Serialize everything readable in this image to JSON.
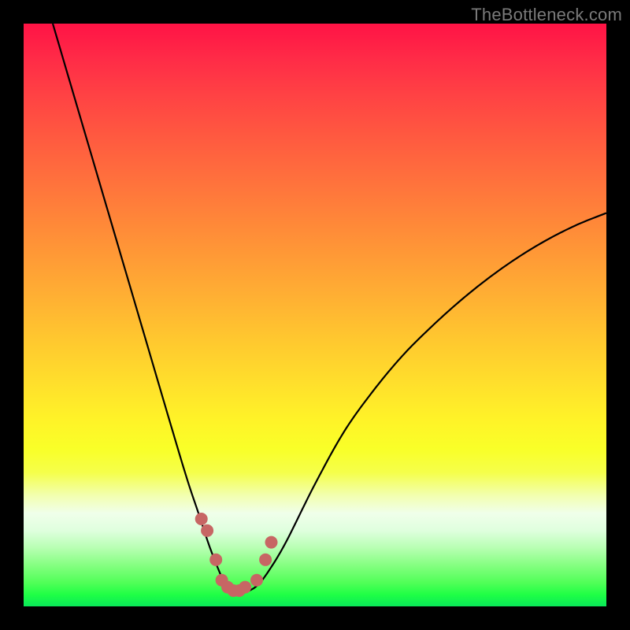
{
  "watermark": "TheBottleneck.com",
  "colors": {
    "frame": "#000000",
    "curve_stroke": "#000000",
    "marker_fill": "#c76664",
    "marker_stroke": "#c76664"
  },
  "chart_data": {
    "type": "line",
    "title": "",
    "xlabel": "",
    "ylabel": "",
    "xlim": [
      0,
      100
    ],
    "ylim": [
      0,
      100
    ],
    "grid": false,
    "legend": false,
    "series": [
      {
        "name": "bottleneck-curve",
        "x": [
          5,
          10,
          15,
          20,
          25,
          28,
          30,
          32,
          34,
          35,
          36,
          37,
          38,
          40,
          42,
          45,
          50,
          55,
          60,
          65,
          70,
          75,
          80,
          85,
          90,
          95,
          100
        ],
        "y": [
          100,
          83,
          66,
          49,
          32,
          22,
          16,
          10,
          5,
          3.2,
          2.4,
          2.2,
          2.4,
          3.5,
          6,
          11,
          21,
          30,
          37,
          43,
          48,
          52.5,
          56.5,
          60,
          63,
          65.5,
          67.5
        ]
      }
    ],
    "markers": {
      "series": "bottleneck-curve",
      "points_x": [
        30.5,
        31.5,
        33,
        34,
        35,
        36,
        37,
        38,
        40,
        41.5,
        42.5
      ],
      "points_y": [
        15,
        13,
        8,
        4.5,
        3.3,
        2.7,
        2.7,
        3.3,
        4.5,
        8,
        11
      ],
      "radius": 7.5
    }
  }
}
